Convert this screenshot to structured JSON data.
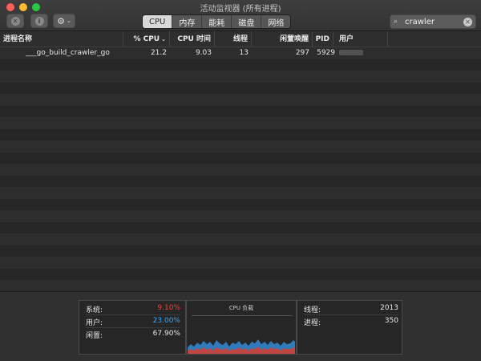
{
  "window": {
    "title": "活动监视器 (所有进程)"
  },
  "toolbar": {
    "close_glyph": "✕",
    "info_glyph": "i",
    "gear_glyph": "⚙",
    "caret_glyph": "⌄",
    "tabs": [
      {
        "label": "CPU",
        "active": true
      },
      {
        "label": "内存",
        "active": false
      },
      {
        "label": "能耗",
        "active": false
      },
      {
        "label": "磁盘",
        "active": false
      },
      {
        "label": "网络",
        "active": false
      }
    ],
    "search": {
      "icon": "magnifier-with-dropdown-icon",
      "glyph": "⌕",
      "value": "crawler",
      "clear_glyph": "✕"
    }
  },
  "table": {
    "columns": [
      "进程名称",
      "% CPU",
      "CPU 时间",
      "线程",
      "闲置唤醒",
      "PID",
      "用户"
    ],
    "sort_indicator": "⌄",
    "rows": [
      {
        "name": "___go_build_crawler_go",
        "cpu": "21.2",
        "cpu_time": "9.03",
        "threads": "13",
        "idle_wakeups": "297",
        "pid": "5929",
        "user": ""
      }
    ]
  },
  "footer": {
    "left": [
      {
        "label": "系统:",
        "value": "9.10%",
        "color": "#ff3b30"
      },
      {
        "label": "用户:",
        "value": "23.00%",
        "color": "#33a6ff"
      },
      {
        "label": "闲置:",
        "value": "67.90%",
        "color": "#e6e6e6"
      }
    ],
    "chart_title": "CPU 负载",
    "right": [
      {
        "label": "线程:",
        "value": "2013"
      },
      {
        "label": "进程:",
        "value": "350"
      }
    ]
  }
}
